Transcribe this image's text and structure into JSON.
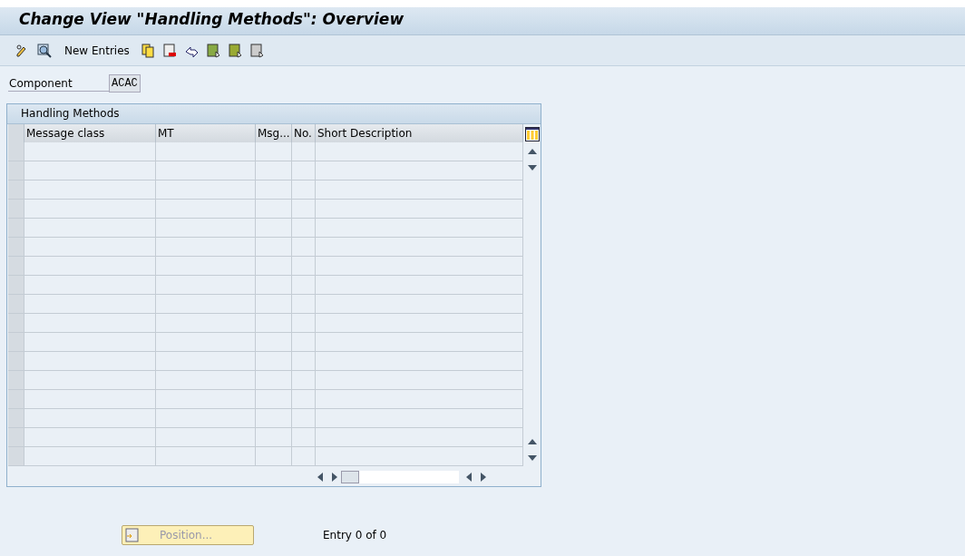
{
  "window": {
    "title": "Change View \"Handling Methods\": Overview"
  },
  "toolbar": {
    "button_label": "New Entries"
  },
  "component": {
    "label": "Component",
    "value": "ACAC"
  },
  "table": {
    "title": "Handling Methods",
    "columns": [
      "Message class",
      "MT",
      "Msg...",
      "No.",
      "Short Description"
    ]
  },
  "position_button": {
    "label": "Position...",
    "disabled": true
  },
  "entry_info": "Entry 0 of 0"
}
